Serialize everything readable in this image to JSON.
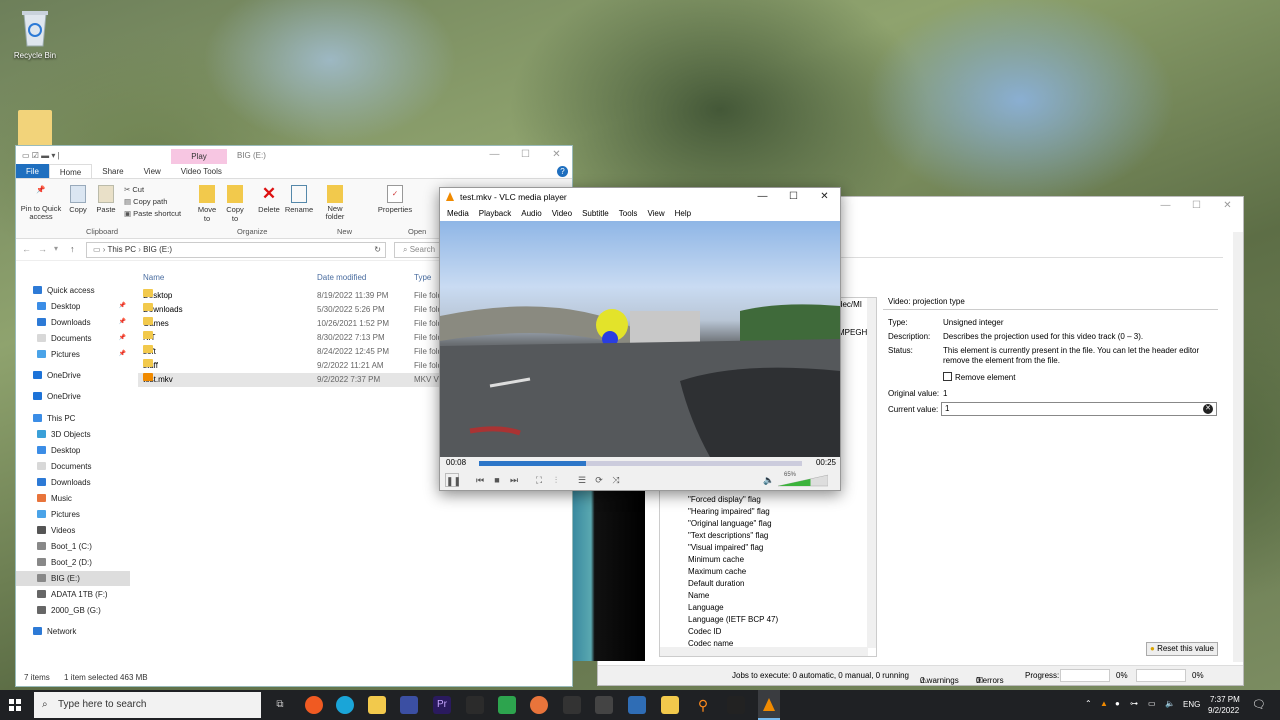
{
  "desktop": {
    "recycle_bin_label": "Recycle Bin"
  },
  "explorer": {
    "title": "BIG (E:)",
    "ribbon_tabs": [
      "File",
      "Home",
      "Share",
      "View",
      "Video Tools"
    ],
    "contextual_tab": "Play",
    "ribbon_buttons": {
      "pin": "Pin to Quick access",
      "copy": "Copy",
      "paste": "Paste",
      "cut": "Cut",
      "copy_path": "Copy path",
      "paste_shortcut": "Paste shortcut",
      "move_to": "Move to",
      "copy_to": "Copy to",
      "delete": "Delete",
      "rename": "Rename",
      "new_folder": "New folder",
      "properties": "Properties"
    },
    "ribbon_groups": [
      "Clipboard",
      "Organize",
      "New",
      "Open"
    ],
    "address": {
      "this_pc": "This PC",
      "drive": "BIG (E:)",
      "search_placeholder": "Search"
    },
    "nav": [
      {
        "label": "Quick access",
        "pinned": false
      },
      {
        "label": "Desktop",
        "pinned": true
      },
      {
        "label": "Downloads",
        "pinned": true
      },
      {
        "label": "Documents",
        "pinned": true
      },
      {
        "label": "Pictures",
        "pinned": true
      },
      {
        "label": "OneDrive",
        "pinned": false
      },
      {
        "label": "OneDrive",
        "pinned": false
      },
      {
        "label": "This PC",
        "pinned": false
      },
      {
        "label": "3D Objects",
        "pinned": false
      },
      {
        "label": "Desktop",
        "pinned": false
      },
      {
        "label": "Documents",
        "pinned": false
      },
      {
        "label": "Downloads",
        "pinned": false
      },
      {
        "label": "Music",
        "pinned": false
      },
      {
        "label": "Pictures",
        "pinned": false
      },
      {
        "label": "Videos",
        "pinned": false
      },
      {
        "label": "Boot_1 (C:)",
        "pinned": false
      },
      {
        "label": "Boot_2 (D:)",
        "pinned": false
      },
      {
        "label": "BIG (E:)",
        "pinned": false
      },
      {
        "label": "ADATA 1TB (F:)",
        "pinned": false
      },
      {
        "label": "2000_GB (G:)",
        "pinned": false
      },
      {
        "label": "Network",
        "pinned": false
      }
    ],
    "columns": [
      "Name",
      "Date modified",
      "Type"
    ],
    "files": [
      {
        "name": "Desktop",
        "date": "8/19/2022 11:39 PM",
        "type": "File fold"
      },
      {
        "name": "Downloads",
        "date": "5/30/2022 5:26 PM",
        "type": "File fold"
      },
      {
        "name": "Games",
        "date": "10/26/2021 1:52 PM",
        "type": "File fold"
      },
      {
        "name": "KIT",
        "date": "8/30/2022 7:13 PM",
        "type": "File fold"
      },
      {
        "name": "soft",
        "date": "8/24/2022 12:45 PM",
        "type": "File fold"
      },
      {
        "name": "stuff",
        "date": "9/2/2022 11:21 AM",
        "type": "File fold"
      },
      {
        "name": "test.mkv",
        "date": "9/2/2022 7:37 PM",
        "type": "MKV Vi"
      }
    ],
    "status_items": "7 items",
    "status_selected": "1 item selected  463 MB"
  },
  "vlc": {
    "title": "test.mkv - VLC media player",
    "menu": [
      "Media",
      "Playback",
      "Audio",
      "Video",
      "Subtitle",
      "Tools",
      "View",
      "Help"
    ],
    "time_elapsed": "00:08",
    "time_total": "00:25",
    "progress": 0.33,
    "volume_label": "65%",
    "volume": 0.65
  },
  "mkv_editor": {
    "truncated_left": [
      "dec/MI",
      "MPEGH/"
    ],
    "tree_items": [
      "\"Forced display\" flag",
      "\"Hearing impaired\" flag",
      "\"Original language\" flag",
      "\"Text descriptions\" flag",
      "\"Visual impaired\" flag",
      "Minimum cache",
      "Maximum cache",
      "Default duration",
      "Name",
      "Language",
      "Language (IETF BCP 47)",
      "Codec ID",
      "Codec name"
    ],
    "property_title": "Video: projection type",
    "type_label": "Type:",
    "type_value": "Unsigned integer",
    "description_label": "Description:",
    "description_value": "Describes the projection used for this video track (0 – 3).",
    "status_label": "Status:",
    "status_value_1": "This element is currently present in the file. You can let the header editor",
    "status_value_2": "remove the element from the file.",
    "remove_element_label": "Remove element",
    "original_value_label": "Original value:",
    "original_value": "1",
    "current_value_label": "Current value:",
    "current_value": "1",
    "reset_button": "Reset this value",
    "jobs": "Jobs to execute:  0 automatic, 0 manual, 0 running",
    "warnings": "0 warnings",
    "errors": "0 errors",
    "progress_label": "Progress:",
    "progress_1": "0%",
    "progress_2": "0%"
  },
  "taskbar": {
    "search_placeholder": "Type here to search",
    "language": "ENG",
    "time": "7:37 PM",
    "date": "9/2/2022"
  }
}
